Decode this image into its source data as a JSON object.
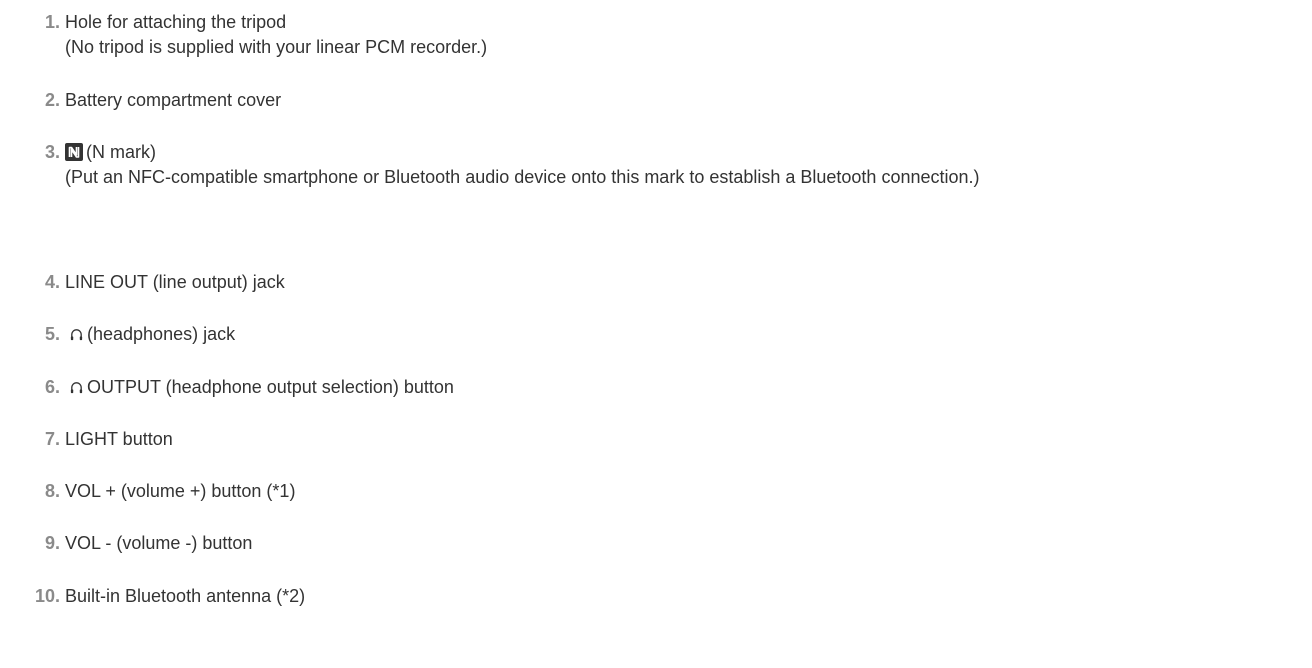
{
  "items": [
    {
      "number": "1.",
      "text": "Hole for attaching the tripod",
      "sub": "(No tripod is supplied with your linear PCM recorder.)"
    },
    {
      "number": "2.",
      "text": "Battery compartment cover"
    },
    {
      "number": "3.",
      "icon": "n-mark-icon",
      "text": "(N mark)",
      "sub": "(Put an NFC-compatible smartphone or Bluetooth audio device onto this mark to establish a Bluetooth connection.)"
    },
    {
      "number": "4.",
      "text": "LINE OUT (line output) jack"
    },
    {
      "number": "5.",
      "icon": "headphones-icon",
      "text": "(headphones) jack"
    },
    {
      "number": "6.",
      "icon": "headphones-icon",
      "text": "OUTPUT (headphone output selection) button"
    },
    {
      "number": "7.",
      "text": "LIGHT button"
    },
    {
      "number": "8.",
      "text": "VOL + (volume +) button (*1)"
    },
    {
      "number": "9.",
      "text": "VOL - (volume -) button"
    },
    {
      "number": "10.",
      "text": "Built-in Bluetooth antenna (*2)"
    }
  ],
  "colors": {
    "number": "#8a8a8a",
    "text": "#333333",
    "background": "#ffffff"
  }
}
